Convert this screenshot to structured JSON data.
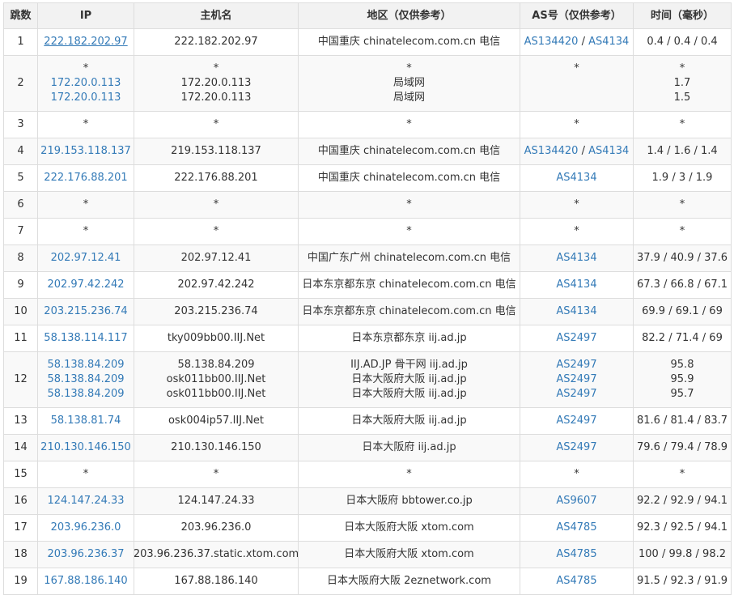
{
  "headers": {
    "hop": "跳数",
    "ip": "IP",
    "host": "主机名",
    "region": "地区（仅供参考）",
    "as": "AS号（仅供参考）",
    "time": "时间（毫秒）"
  },
  "rows": [
    {
      "hop": "1",
      "ip": [
        "222.182.202.97"
      ],
      "host": [
        "222.182.202.97"
      ],
      "region": [
        "中国重庆 chinatelecom.com.cn 电信"
      ],
      "as": [
        [
          "AS134420",
          "AS4134"
        ]
      ],
      "time": [
        "0.4 / 0.4 / 0.4"
      ]
    },
    {
      "hop": "2",
      "ip": [
        "*",
        "172.20.0.113",
        "172.20.0.113"
      ],
      "host": [
        "*",
        "172.20.0.113",
        "172.20.0.113"
      ],
      "region": [
        "*",
        "局域网",
        "局域网"
      ],
      "as": [
        [
          "*"
        ],
        [],
        []
      ],
      "time": [
        "*",
        "1.7",
        "1.5"
      ]
    },
    {
      "hop": "3",
      "ip": [
        "*"
      ],
      "host": [
        "*"
      ],
      "region": [
        "*"
      ],
      "as": [
        [
          "*"
        ]
      ],
      "time": [
        "*"
      ]
    },
    {
      "hop": "4",
      "ip": [
        "219.153.118.137"
      ],
      "host": [
        "219.153.118.137"
      ],
      "region": [
        "中国重庆 chinatelecom.com.cn 电信"
      ],
      "as": [
        [
          "AS134420",
          "AS4134"
        ]
      ],
      "time": [
        "1.4 / 1.6 / 1.4"
      ]
    },
    {
      "hop": "5",
      "ip": [
        "222.176.88.201"
      ],
      "host": [
        "222.176.88.201"
      ],
      "region": [
        "中国重庆 chinatelecom.com.cn 电信"
      ],
      "as": [
        [
          "AS4134"
        ]
      ],
      "time": [
        "1.9 / 3 / 1.9"
      ]
    },
    {
      "hop": "6",
      "ip": [
        "*"
      ],
      "host": [
        "*"
      ],
      "region": [
        "*"
      ],
      "as": [
        [
          "*"
        ]
      ],
      "time": [
        "*"
      ]
    },
    {
      "hop": "7",
      "ip": [
        "*"
      ],
      "host": [
        "*"
      ],
      "region": [
        "*"
      ],
      "as": [
        [
          "*"
        ]
      ],
      "time": [
        "*"
      ]
    },
    {
      "hop": "8",
      "ip": [
        "202.97.12.41"
      ],
      "host": [
        "202.97.12.41"
      ],
      "region": [
        "中国广东广州 chinatelecom.com.cn 电信"
      ],
      "as": [
        [
          "AS4134"
        ]
      ],
      "time": [
        "37.9 / 40.9 / 37.6"
      ]
    },
    {
      "hop": "9",
      "ip": [
        "202.97.42.242"
      ],
      "host": [
        "202.97.42.242"
      ],
      "region": [
        "日本东京都东京 chinatelecom.com.cn 电信"
      ],
      "as": [
        [
          "AS4134"
        ]
      ],
      "time": [
        "67.3 / 66.8 / 67.1"
      ]
    },
    {
      "hop": "10",
      "ip": [
        "203.215.236.74"
      ],
      "host": [
        "203.215.236.74"
      ],
      "region": [
        "日本东京都东京 chinatelecom.com.cn 电信"
      ],
      "as": [
        [
          "AS4134"
        ]
      ],
      "time": [
        "69.9 / 69.1 / 69"
      ]
    },
    {
      "hop": "11",
      "ip": [
        "58.138.114.117"
      ],
      "host": [
        "tky009bb00.IIJ.Net"
      ],
      "region": [
        "日本东京都东京 iij.ad.jp"
      ],
      "as": [
        [
          "AS2497"
        ]
      ],
      "time": [
        "82.2 / 71.4 / 69"
      ]
    },
    {
      "hop": "12",
      "ip": [
        "58.138.84.209",
        "58.138.84.209",
        "58.138.84.209"
      ],
      "host": [
        "58.138.84.209",
        "osk011bb00.IIJ.Net",
        "osk011bb00.IIJ.Net"
      ],
      "region": [
        "IIJ.AD.JP 骨干网 iij.ad.jp",
        "日本大阪府大阪 iij.ad.jp",
        "日本大阪府大阪 iij.ad.jp"
      ],
      "as": [
        [
          "AS2497"
        ],
        [
          "AS2497"
        ],
        [
          "AS2497"
        ]
      ],
      "time": [
        "95.8",
        "95.9",
        "95.7"
      ]
    },
    {
      "hop": "13",
      "ip": [
        "58.138.81.74"
      ],
      "host": [
        "osk004ip57.IIJ.Net"
      ],
      "region": [
        "日本大阪府大阪 iij.ad.jp"
      ],
      "as": [
        [
          "AS2497"
        ]
      ],
      "time": [
        "81.6 / 81.4 / 83.7"
      ]
    },
    {
      "hop": "14",
      "ip": [
        "210.130.146.150"
      ],
      "host": [
        "210.130.146.150"
      ],
      "region": [
        "日本大阪府 iij.ad.jp"
      ],
      "as": [
        [
          "AS2497"
        ]
      ],
      "time": [
        "79.6 / 79.4 / 78.9"
      ]
    },
    {
      "hop": "15",
      "ip": [
        "*"
      ],
      "host": [
        "*"
      ],
      "region": [
        "*"
      ],
      "as": [
        [
          "*"
        ]
      ],
      "time": [
        "*"
      ]
    },
    {
      "hop": "16",
      "ip": [
        "124.147.24.33"
      ],
      "host": [
        "124.147.24.33"
      ],
      "region": [
        "日本大阪府 bbtower.co.jp"
      ],
      "as": [
        [
          "AS9607"
        ]
      ],
      "time": [
        "92.2 / 92.9 / 94.1"
      ]
    },
    {
      "hop": "17",
      "ip": [
        "203.96.236.0"
      ],
      "host": [
        "203.96.236.0"
      ],
      "region": [
        "日本大阪府大阪 xtom.com"
      ],
      "as": [
        [
          "AS4785"
        ]
      ],
      "time": [
        "92.3 / 92.5 / 94.1"
      ]
    },
    {
      "hop": "18",
      "ip": [
        "203.96.236.37"
      ],
      "host": [
        "203.96.236.37.static.xtom.com"
      ],
      "region": [
        "日本大阪府大阪 xtom.com"
      ],
      "as": [
        [
          "AS4785"
        ]
      ],
      "time": [
        "100 / 99.8 / 98.2"
      ]
    },
    {
      "hop": "19",
      "ip": [
        "167.88.186.140"
      ],
      "host": [
        "167.88.186.140"
      ],
      "region": [
        "日本大阪府大阪 2eznetwork.com"
      ],
      "as": [
        [
          "AS4785"
        ]
      ],
      "time": [
        "91.5 / 92.3 / 91.9"
      ]
    }
  ],
  "colors": {
    "link": "#337ab7",
    "header_bg": "#f2f2f2",
    "stripe_bg": "#f9f9f9",
    "border": "#dddddd",
    "text": "#333333"
  }
}
